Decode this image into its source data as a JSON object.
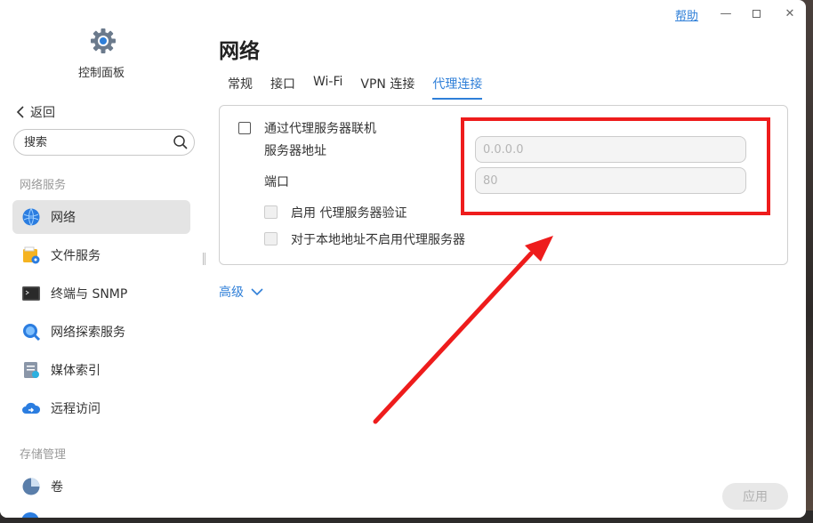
{
  "window": {
    "help_label": "帮助",
    "minimize_glyph": "—",
    "maximize_glyph": "☐",
    "close_glyph": "✕"
  },
  "sidebar": {
    "app_title": "控制面板",
    "back_label": "返回",
    "search_placeholder": "搜索",
    "group1_label": "网络服务",
    "group2_label": "存储管理",
    "items": [
      {
        "label": "网络",
        "icon": "globe-icon"
      },
      {
        "label": "文件服务",
        "icon": "file-service-icon"
      },
      {
        "label": "终端与 SNMP",
        "icon": "terminal-icon"
      },
      {
        "label": "网络探索服务",
        "icon": "discovery-icon"
      },
      {
        "label": "媒体索引",
        "icon": "media-index-icon"
      },
      {
        "label": "远程访问",
        "icon": "cloud-icon"
      },
      {
        "label": "卷",
        "icon": "volume-icon"
      }
    ]
  },
  "main": {
    "title": "网络",
    "tabs": [
      {
        "label": "常规"
      },
      {
        "label": "接口"
      },
      {
        "label": "Wi-Fi"
      },
      {
        "label": "VPN 连接"
      },
      {
        "label": "代理连接"
      }
    ],
    "proxy": {
      "enable_label": "通过代理服务器联机",
      "server_label": "服务器地址",
      "server_placeholder": "0.0.0.0",
      "port_label": "端口",
      "port_placeholder": "80",
      "auth_label": "启用 代理服务器验证",
      "bypass_label": "对于本地地址不启用代理服务器"
    },
    "advanced_label": "高级",
    "apply_label": "应用"
  },
  "colors": {
    "accent": "#2f7fd8",
    "annotation": "#ee1c1c"
  }
}
